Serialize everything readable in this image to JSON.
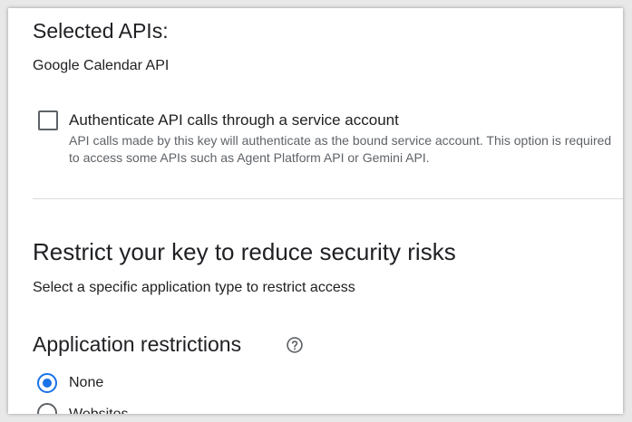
{
  "selected_apis": {
    "heading": "Selected APIs:",
    "items": [
      "Google Calendar API"
    ]
  },
  "service_account": {
    "label": "Authenticate API calls through a service account",
    "description": "API calls made by this key will authenticate as the bound service account. This option is required to access some APIs such as Agent Platform API or Gemini API.",
    "checked": false
  },
  "restrict": {
    "heading": "Restrict your key to reduce security risks",
    "subtext": "Select a specific application type to restrict access"
  },
  "app_restrictions": {
    "heading": "Application restrictions",
    "help_icon": "help-outline-icon",
    "options": [
      {
        "label": "None",
        "selected": true
      },
      {
        "label": "Websites",
        "selected": false
      }
    ]
  },
  "colors": {
    "accent": "#1a73e8",
    "text_primary": "#202124",
    "text_secondary": "#5f6368",
    "divider": "#dadce0"
  }
}
